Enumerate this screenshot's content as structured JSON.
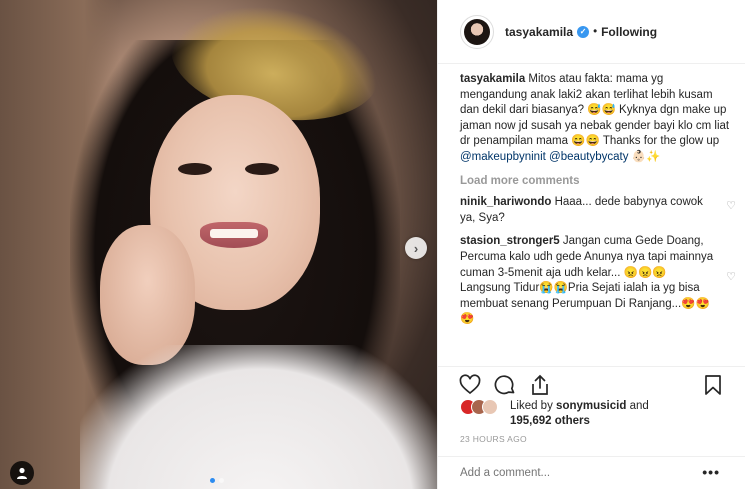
{
  "post": {
    "username": "tasyakamila",
    "follow_status": "Following",
    "separator": "•",
    "caption": {
      "username": "tasyakamila",
      "text": "Mitos atau fakta: mama yg mengandung anak laki2 akan terlihat lebih kusam dan dekil dari biasanya? 😅😅 Kyknya dgn make up jaman now jd susah ya nebak gender bayi klo cm liat dr penampilan mama 😄😄 Thanks for the glow up",
      "mention1": "@makeupbyninit",
      "mention2": "@beautybycaty",
      "tail": "👶🏻✨"
    },
    "load_more": "Load more comments",
    "comments": [
      {
        "username": "ninik_hariwondo",
        "text": "Haaa... dede babynya cowok ya, Sya?"
      },
      {
        "username": "stasion_stronger5",
        "text": "Jangan cuma Gede Doang, Percuma kalo udh gede Anunya nya tapi mainnya cuman 3-5menit aja udh kelar... 😠😠😠 Langsung Tidur😭😭Pria Sejati ialah ia yg bisa membuat senang Perumpuan Di Ranjang...😍😍😍"
      }
    ],
    "likes": {
      "prefix": "Liked by",
      "user": "sonymusicid",
      "and": "and",
      "others": "195,692 others"
    },
    "timestamp": "23 HOURS AGO",
    "add_comment_placeholder": "Add a comment...",
    "more_glyph": "•••",
    "icons": {
      "like": "heart-icon",
      "comment": "comment-icon",
      "share": "share-icon",
      "save": "bookmark-icon",
      "next": "chevron-right-icon",
      "tag": "user-tag-icon"
    },
    "colors": {
      "verified": "#3897f0",
      "mention": "#003569",
      "carousel_active": "#2d8cf0"
    }
  }
}
